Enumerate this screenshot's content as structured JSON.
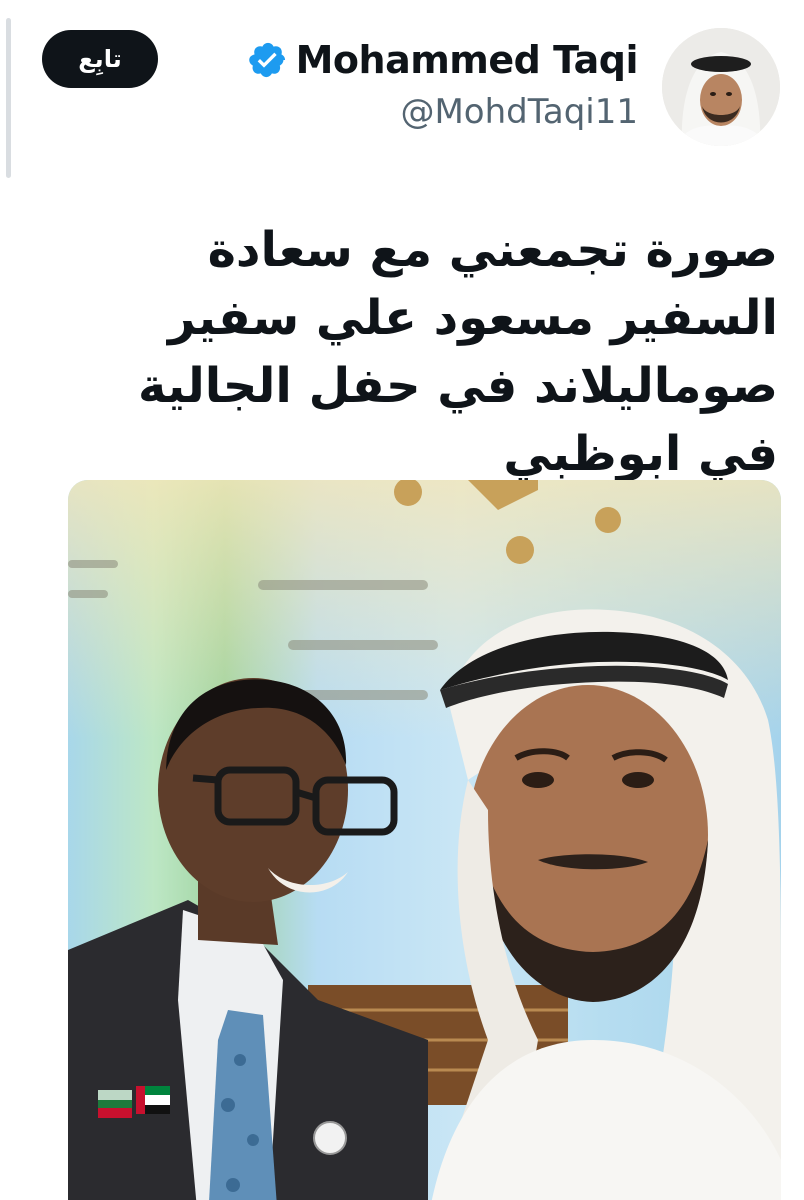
{
  "header": {
    "follow_label": "تابِع",
    "display_name": "Mohammed Taqi",
    "handle": "@MohdTaqi11",
    "verified": true
  },
  "tweet": {
    "text": "صورة تجمعني مع سعادة السفير مسعود علي سفير صوماليلاند في حفل الجالية في ابوظبي"
  },
  "colors": {
    "follow_bg": "#0f1419",
    "verified_blue": "#1d9bf0",
    "handle_gray": "#536471"
  }
}
